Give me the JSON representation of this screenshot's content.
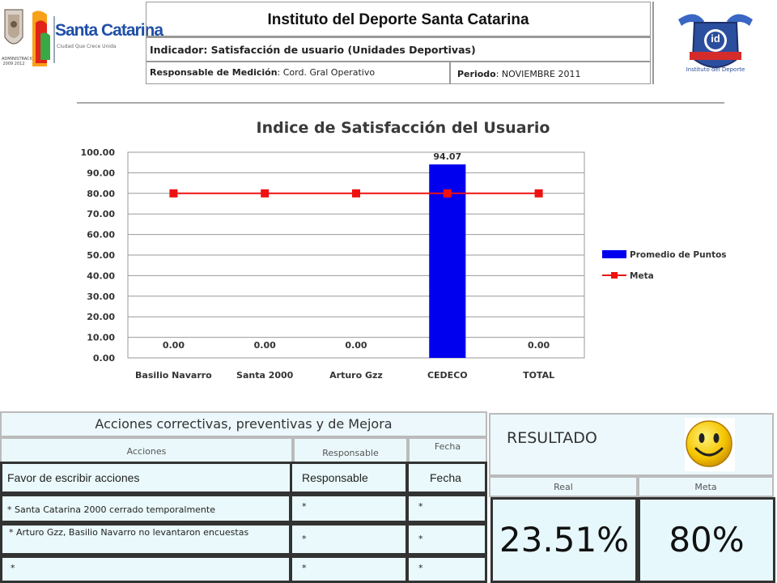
{
  "header": {
    "title": "Instituto del Deporte Santa Catarina",
    "indicator": "Indicador: Satisfacción de usuario (Unidades Deportivas)",
    "responsable_label": "Responsable de Medición",
    "responsable_value": ": Cord. Gral Operativo",
    "periodo_label": "Periodo",
    "periodo_value": ": NOVIEMBRE 2011",
    "logo_left_name": "Santa Catarina",
    "logo_left_tagline": "Ciudad Que Crece Unida",
    "logo_right_text": "id",
    "logo_right_caption": "Instituto del Deporte",
    "seal_text": "ADMINISTRACIÓN 2009 2012"
  },
  "chart_data": {
    "type": "bar",
    "title": "Indice de Satisfacción del Usuario",
    "categories": [
      "Basilio Navarro",
      "Santa 2000",
      "Arturo Gzz",
      "CEDECO",
      "TOTAL"
    ],
    "series": [
      {
        "name": "Promedio de Puntos",
        "type": "bar",
        "color": "#0000ee",
        "values": [
          0.0,
          0.0,
          0.0,
          94.07,
          0.0
        ],
        "labels": [
          "0.00",
          "0.00",
          "0.00",
          "94.07",
          "0.00"
        ]
      },
      {
        "name": "Meta",
        "type": "line",
        "color": "#ee1111",
        "values": [
          80,
          80,
          80,
          80,
          80
        ]
      }
    ],
    "ylim": [
      0,
      100
    ],
    "yticks": [
      "0.00",
      "10.00",
      "20.00",
      "30.00",
      "40.00",
      "50.00",
      "60.00",
      "70.00",
      "80.00",
      "90.00",
      "100.00"
    ],
    "grid": true,
    "legend": "right"
  },
  "actions": {
    "title": "Acciones correctivas, preventivas y de Mejora",
    "headers": {
      "acciones": "Acciones",
      "responsable": "Responsable",
      "fecha": "Fecha"
    },
    "rows": [
      {
        "accion": "Favor de escribir acciones",
        "responsable": "Responsable",
        "fecha": "Fecha"
      },
      {
        "accion": "* Santa Catarina 2000 cerrado temporalmente",
        "responsable": "*",
        "fecha": "*"
      },
      {
        "accion": "* Arturo Gzz, Basilio Navarro no levantaron encuestas",
        "responsable": "*",
        "fecha": "*"
      },
      {
        "accion": "*",
        "responsable": "*",
        "fecha": "*"
      }
    ]
  },
  "result": {
    "label": "RESULTADO",
    "real_label": "Real",
    "meta_label": "Meta",
    "real_value": "23.51%",
    "meta_value": "80%",
    "icon": "smiley-face-icon"
  }
}
